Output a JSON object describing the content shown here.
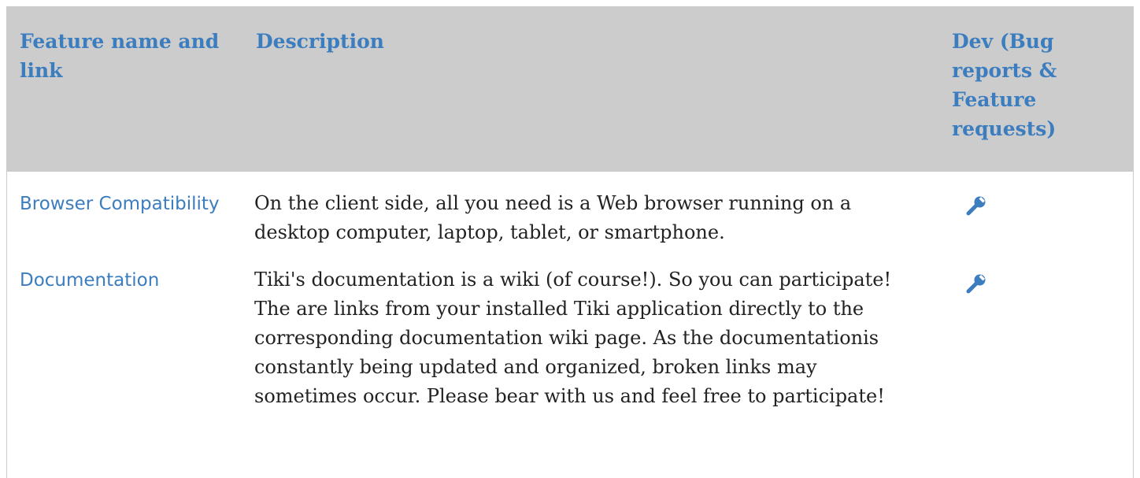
{
  "table": {
    "headers": [
      "Feature name and link",
      "Description",
      "Dev (Bug reports & Feature requests)"
    ],
    "rows": [
      {
        "feature": "Browser Compatibility",
        "description": "On the client side, all you need is a Web browser running on a desktop computer, laptop, tablet, or smartphone.",
        "dev_icon": "wrench-icon"
      },
      {
        "feature": "Documentation",
        "description": "Tiki's documentation is a wiki (of course!). So you can participate! The are links from your installed Tiki application directly to the corresponding documentation wiki page. As the documentationis constantly being updated and organized, broken links may sometimes occur. Please bear with us and feel free to participate!",
        "dev_icon": "wrench-icon"
      }
    ]
  },
  "colors": {
    "header_bg": "#cccccc",
    "link": "#3b7dbe",
    "text": "#222222"
  }
}
